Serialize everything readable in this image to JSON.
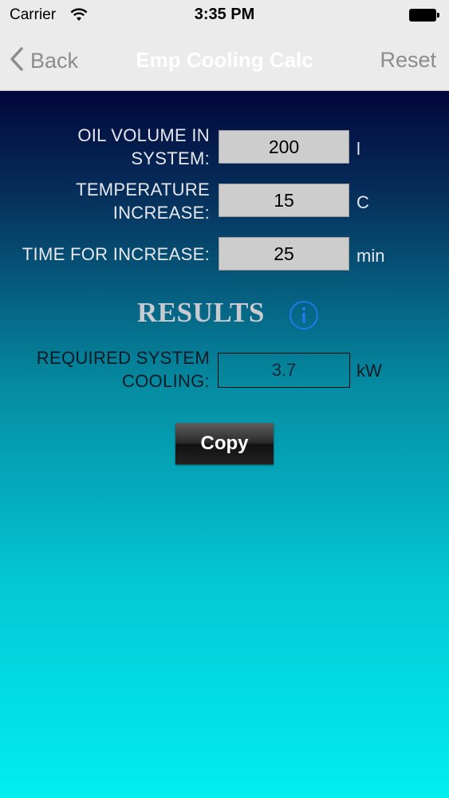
{
  "status_bar": {
    "carrier": "Carrier",
    "time": "3:35 PM"
  },
  "nav": {
    "back_label": "Back",
    "title": "Emp Cooling Calc",
    "reset_label": "Reset"
  },
  "inputs": [
    {
      "label_line1": "OIL VOLUME IN",
      "label_line2": "SYSTEM:",
      "value": "200",
      "unit": "l"
    },
    {
      "label_line1": "TEMPERATURE",
      "label_line2": "INCREASE:",
      "value": "15",
      "unit": "C"
    },
    {
      "label_line1": "TIME FOR INCREASE:",
      "value": "25",
      "unit": "min"
    }
  ],
  "results": {
    "title": "RESULTS",
    "label_line1": "REQUIRED SYSTEM",
    "label_line2": "COOLING:",
    "value": "3.7",
    "unit": "kW"
  },
  "copy_button": {
    "label": "Copy"
  },
  "colors": {
    "nav_text": "#ffffff",
    "info_accent": "#1e7ae8",
    "gradient_top": "#02063a",
    "gradient_bottom": "#00eef0"
  }
}
